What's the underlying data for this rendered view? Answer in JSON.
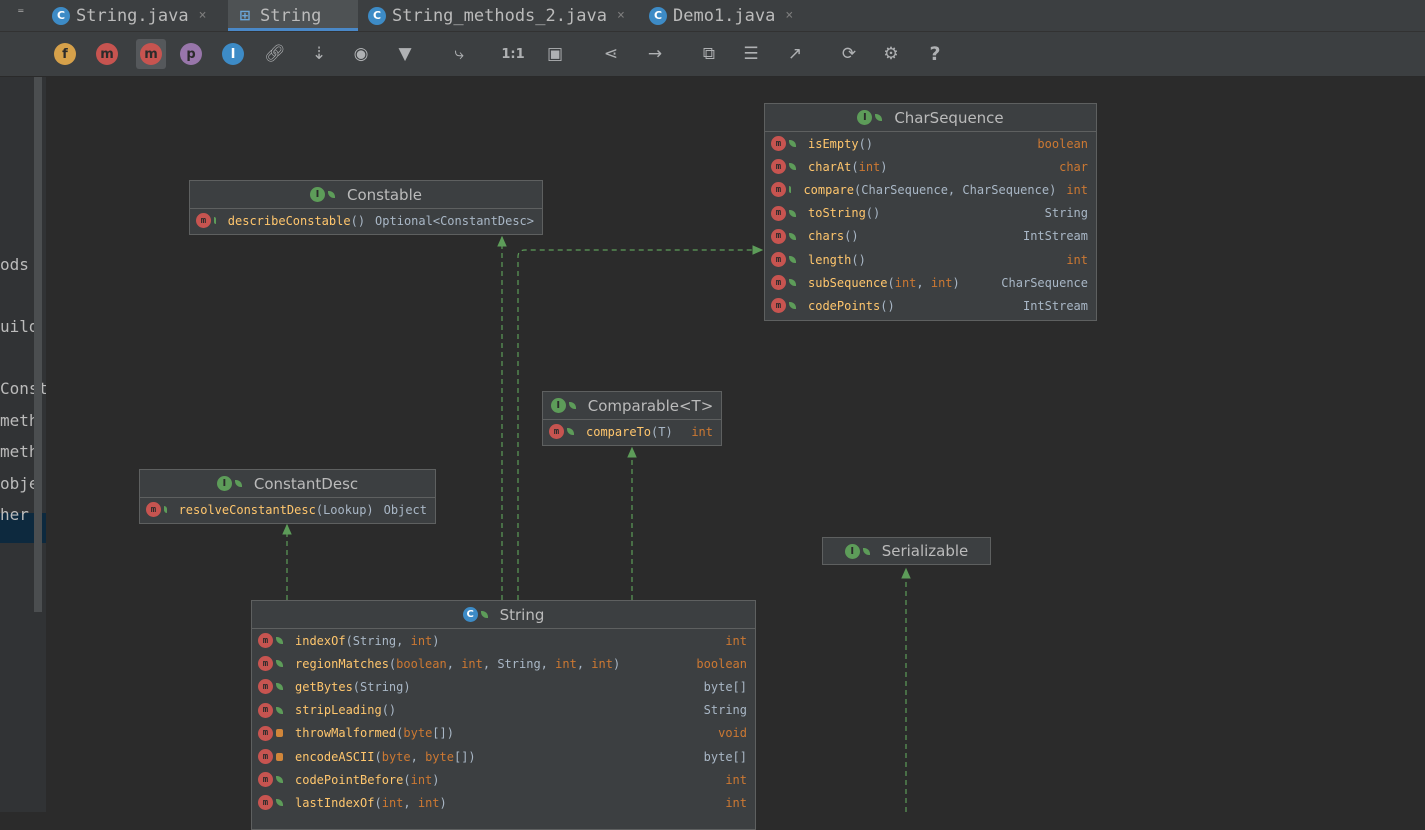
{
  "tabs": [
    {
      "label": "String.java",
      "icon": "class-icon",
      "close": "×"
    },
    {
      "label": "String",
      "icon": "diagram-icon",
      "close": "",
      "active": true
    },
    {
      "label": "String_methods_2.java",
      "icon": "class-icon",
      "close": "×"
    },
    {
      "label": "Demo1.java",
      "icon": "class-icon",
      "close": "×"
    }
  ],
  "tab_menu": "⁼",
  "toolbar": {
    "fields": "f",
    "constructors": "m",
    "methods": "m",
    "properties": "p",
    "inner": "I",
    "actual_size": "1:1",
    "help": "?"
  },
  "left_panel": [
    "ods",
    "uild",
    "Const",
    "meth",
    "meth",
    "obje",
    "her"
  ],
  "nodes": {
    "charsequence": {
      "title": "CharSequence",
      "methods": [
        {
          "name": "isEmpty",
          "params": "()",
          "ret": "boolean"
        },
        {
          "name": "charAt",
          "params": "(int)",
          "ret": "char"
        },
        {
          "name": "compare",
          "params": "(CharSequence, CharSequence)",
          "ret": "int"
        },
        {
          "name": "toString",
          "params": "()",
          "ret": "String"
        },
        {
          "name": "chars",
          "params": "()",
          "ret": "IntStream"
        },
        {
          "name": "length",
          "params": "()",
          "ret": "int"
        },
        {
          "name": "subSequence",
          "params": "(int, int)",
          "ret": "CharSequence"
        },
        {
          "name": "codePoints",
          "params": "()",
          "ret": "IntStream"
        }
      ]
    },
    "constable": {
      "title": "Constable",
      "methods": [
        {
          "name": "describeConstable",
          "params": "()",
          "ret": "Optional<ConstantDesc>"
        }
      ]
    },
    "comparable": {
      "title": "Comparable<T>",
      "methods": [
        {
          "name": "compareTo",
          "params": "(T)",
          "ret": "int"
        }
      ]
    },
    "constantdesc": {
      "title": "ConstantDesc",
      "methods": [
        {
          "name": "resolveConstantDesc",
          "params": "(Lookup)",
          "ret": "Object"
        }
      ]
    },
    "serializable": {
      "title": "Serializable"
    },
    "string": {
      "title": "String",
      "methods": [
        {
          "name": "indexOf",
          "params": "(String, int)",
          "ret": "int"
        },
        {
          "name": "regionMatches",
          "params": "(boolean, int, String, int, int)",
          "ret": "boolean"
        },
        {
          "name": "getBytes",
          "params": "(String)",
          "ret": "byte[]"
        },
        {
          "name": "stripLeading",
          "params": "()",
          "ret": "String"
        },
        {
          "name": "throwMalformed",
          "params": "(byte[])",
          "ret": "void"
        },
        {
          "name": "encodeASCII",
          "params": "(byte, byte[])",
          "ret": "byte[]"
        },
        {
          "name": "codePointBefore",
          "params": "(int)",
          "ret": "int"
        },
        {
          "name": "lastIndexOf",
          "params": "(int, int)",
          "ret": "int"
        }
      ]
    }
  },
  "colors": {
    "arrow": "#5d9c59",
    "method_name": "#ffc66d",
    "keyword": "#cc7832"
  }
}
